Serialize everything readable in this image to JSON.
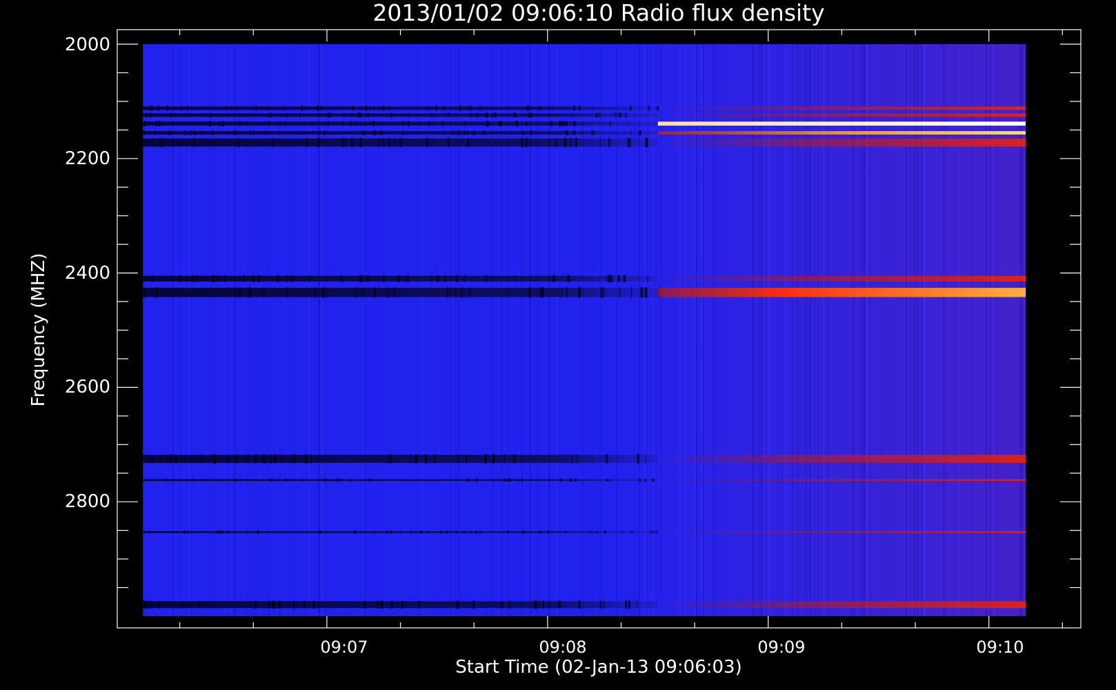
{
  "chart_data": {
    "type": "heatmap",
    "title": "2013/01/02 09:06:10 Radio flux density",
    "xlabel": "Start Time (02-Jan-13 09:06:03)",
    "ylabel": "Frequency (MHZ)",
    "x_ticks": [
      "09:07",
      "09:08",
      "09:09",
      "09:10"
    ],
    "x_tick_seconds": [
      57,
      117,
      177,
      237
    ],
    "y_ticks": [
      2000,
      2200,
      2400,
      2600,
      2800
    ],
    "ylim": [
      2000,
      3000
    ],
    "y_inverted": true,
    "data_extent": {
      "time_seconds": [
        7,
        247
      ],
      "frequency_mhz": [
        2000,
        3000
      ]
    },
    "background_color": "#2222ee",
    "emission_start_seconds": 147,
    "bands": [
      {
        "freq_mhz": 2112,
        "width_mhz": 6,
        "before": "dark",
        "after": "red"
      },
      {
        "freq_mhz": 2124,
        "width_mhz": 6,
        "before": "dark",
        "after": "red"
      },
      {
        "freq_mhz": 2139,
        "width_mhz": 7,
        "before": "dark",
        "after": "white"
      },
      {
        "freq_mhz": 2155,
        "width_mhz": 6,
        "before": "dark",
        "after": "yellow"
      },
      {
        "freq_mhz": 2172,
        "width_mhz": 14,
        "before": "dark",
        "after": "red"
      },
      {
        "freq_mhz": 2410,
        "width_mhz": 10,
        "before": "dark",
        "after": "red"
      },
      {
        "freq_mhz": 2434,
        "width_mhz": 16,
        "before": "dark",
        "after": "orange"
      },
      {
        "freq_mhz": 2725,
        "width_mhz": 14,
        "before": "dark",
        "after": "red"
      },
      {
        "freq_mhz": 2762,
        "width_mhz": 3,
        "before": "dark",
        "after": "red"
      },
      {
        "freq_mhz": 2853,
        "width_mhz": 3,
        "before": "dark",
        "after": "red"
      },
      {
        "freq_mhz": 2980,
        "width_mhz": 12,
        "before": "dark",
        "after": "red"
      }
    ]
  }
}
